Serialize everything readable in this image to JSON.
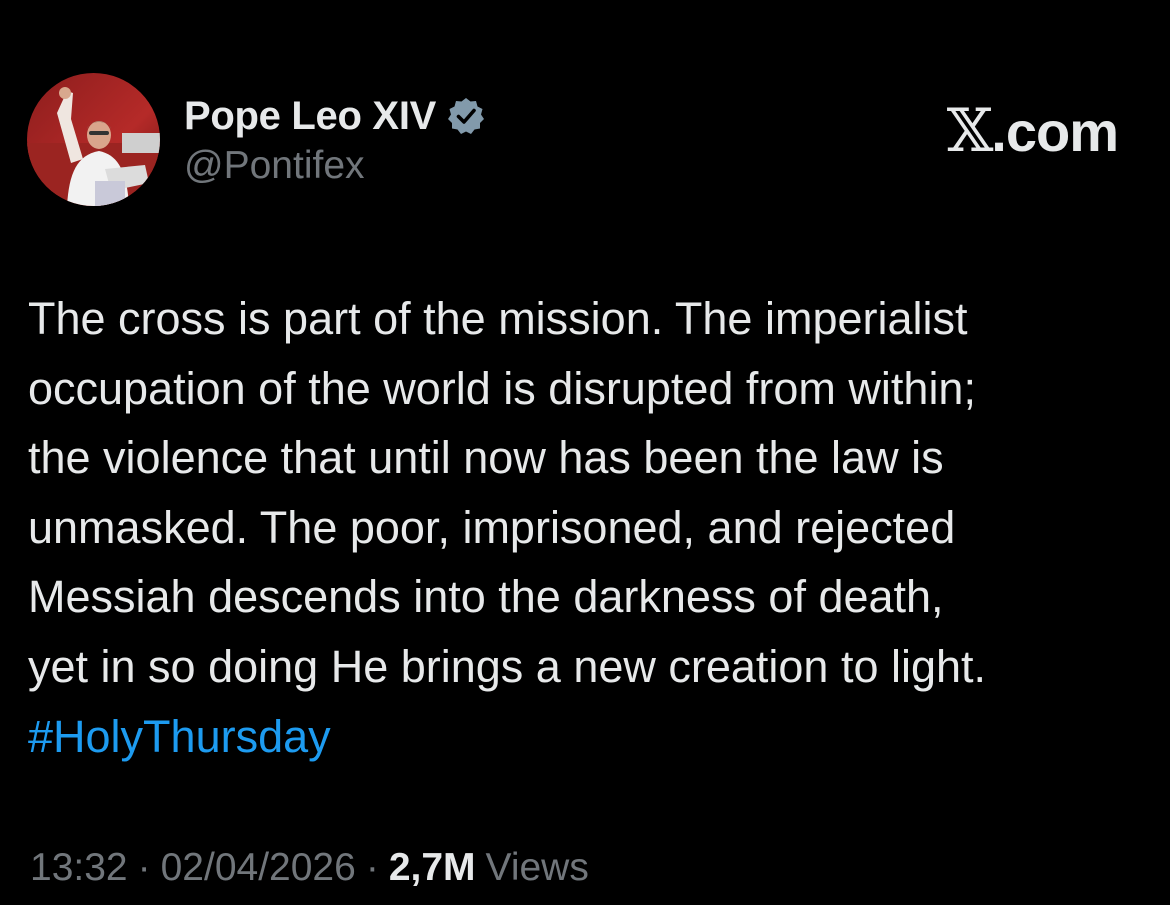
{
  "author": {
    "name": "Pope Leo XIV",
    "handle": "@Pontifex",
    "verified": true
  },
  "brand": {
    "x_glyph": "𝕏",
    "suffix": ".com"
  },
  "tweet": {
    "lines": [
      "The cross is part of the mission. The imperialist",
      "occupation of the world is disrupted from within;",
      "the violence that until now has been the law is",
      "unmasked. The poor, imprisoned, and rejected",
      "Messiah descends into the darkness of death,",
      "yet in so doing He brings a new creation to light."
    ],
    "hashtag": "#HolyThursday"
  },
  "meta": {
    "time": "13:32",
    "separator": "·",
    "date": "02/04/2026",
    "views_count": "2,7M",
    "views_label": "Views"
  },
  "colors": {
    "background": "#000000",
    "text_primary": "#e7e9ea",
    "text_secondary": "#71767b",
    "link": "#1d9bf0",
    "verified_badge": "#829aab"
  },
  "icons": {
    "avatar": "profile-photo",
    "verified": "verified-badge-icon",
    "brand": "x-logo"
  }
}
